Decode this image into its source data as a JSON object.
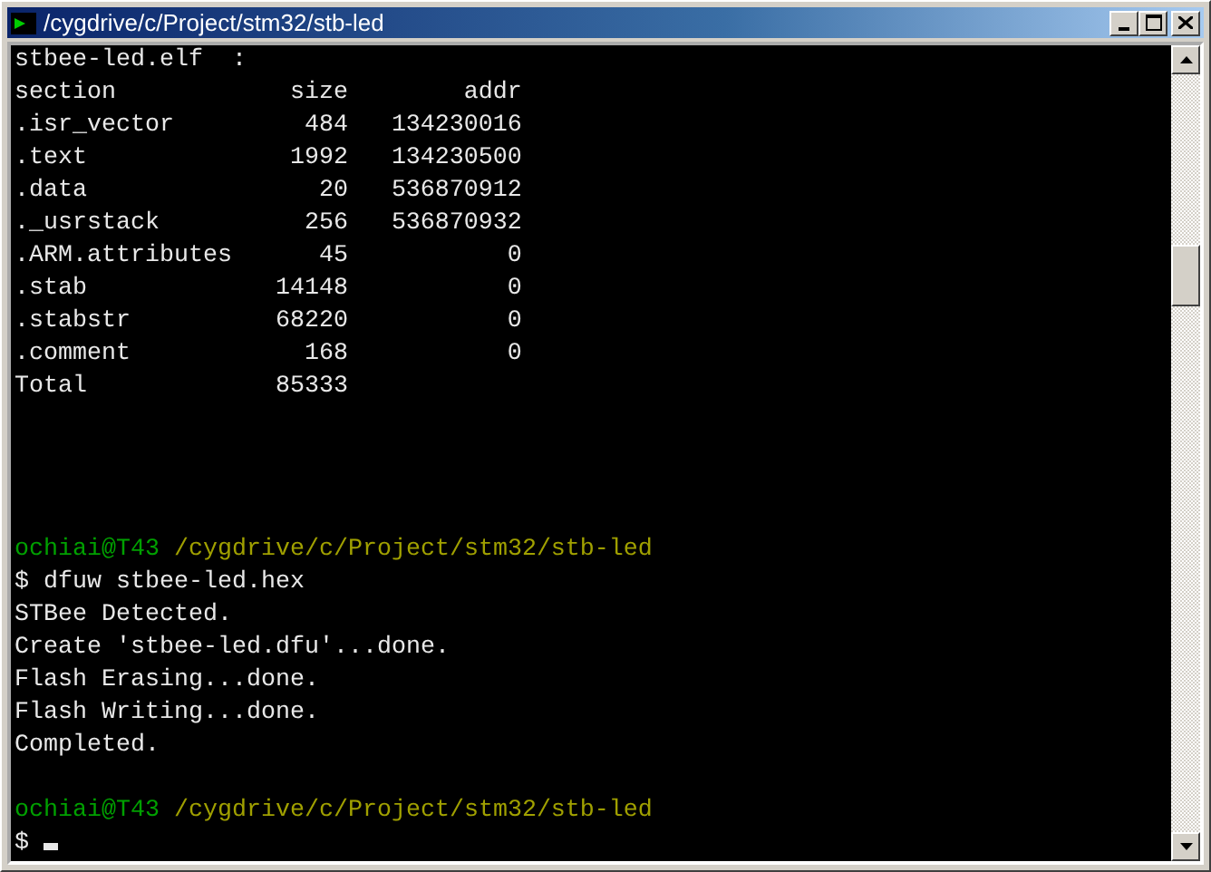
{
  "window": {
    "title": "/cygdrive/c/Project/stm32/stb-led"
  },
  "terminal": {
    "header": "stbee-led.elf  :",
    "table": {
      "columns": [
        "section",
        "size",
        "addr"
      ],
      "rows": [
        [
          ".isr_vector",
          "484",
          "134230016"
        ],
        [
          ".text",
          "1992",
          "134230500"
        ],
        [
          ".data",
          "20",
          "536870912"
        ],
        [
          "._usrstack",
          "256",
          "536870932"
        ],
        [
          ".ARM.attributes",
          "45",
          "0"
        ],
        [
          ".stab",
          "14148",
          "0"
        ],
        [
          ".stabstr",
          "68220",
          "0"
        ],
        [
          ".comment",
          "168",
          "0"
        ],
        [
          "Total",
          "85333",
          ""
        ]
      ]
    },
    "lines": [
      {
        "kind": "blank"
      },
      {
        "kind": "blank"
      },
      {
        "kind": "blank"
      },
      {
        "kind": "blank"
      },
      {
        "kind": "prompt",
        "user": "ochiai@T43",
        "path": "/cygdrive/c/Project/stm32/stb-led"
      },
      {
        "kind": "text",
        "text": "$ dfuw stbee-led.hex"
      },
      {
        "kind": "text",
        "text": "STBee Detected."
      },
      {
        "kind": "text",
        "text": "Create 'stbee-led.dfu'...done."
      },
      {
        "kind": "text",
        "text": "Flash Erasing...done."
      },
      {
        "kind": "text",
        "text": "Flash Writing...done."
      },
      {
        "kind": "text",
        "text": "Completed."
      },
      {
        "kind": "blank"
      },
      {
        "kind": "prompt",
        "user": "ochiai@T43",
        "path": "/cygdrive/c/Project/stm32/stb-led"
      },
      {
        "kind": "input",
        "text": "$"
      }
    ]
  }
}
